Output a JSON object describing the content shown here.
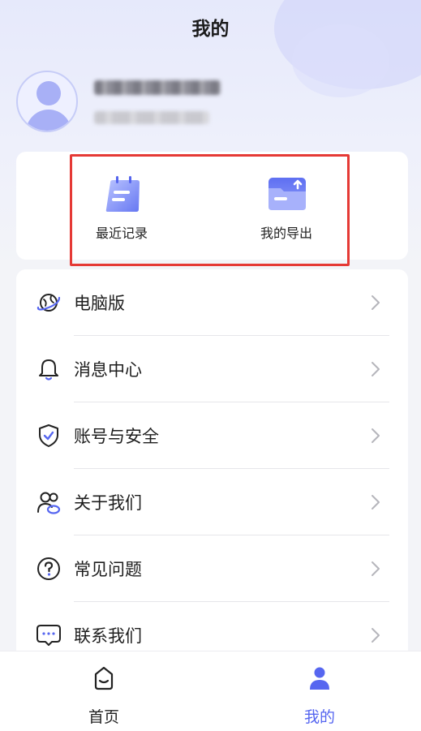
{
  "header": {
    "title": "我的"
  },
  "profile": {
    "avatar_icon": "user-avatar-icon"
  },
  "quick_actions": [
    {
      "label": "最近记录",
      "icon": "notepad-icon"
    },
    {
      "label": "我的导出",
      "icon": "folder-upload-icon"
    }
  ],
  "menu": [
    {
      "label": "电脑版",
      "icon": "planet-icon"
    },
    {
      "label": "消息中心",
      "icon": "bell-icon"
    },
    {
      "label": "账号与安全",
      "icon": "shield-check-icon"
    },
    {
      "label": "关于我们",
      "icon": "people-icon"
    },
    {
      "label": "常见问题",
      "icon": "question-circle-icon"
    },
    {
      "label": "联系我们",
      "icon": "chat-bubble-icon"
    }
  ],
  "tabbar": {
    "items": [
      {
        "label": "首页",
        "icon": "home-face-icon",
        "active": false
      },
      {
        "label": "我的",
        "icon": "person-icon",
        "active": true
      }
    ]
  },
  "colors": {
    "accent": "#5666f0",
    "highlight_border": "#e53935",
    "inactive_tab": "#222222",
    "background": "#f3f4f8"
  }
}
